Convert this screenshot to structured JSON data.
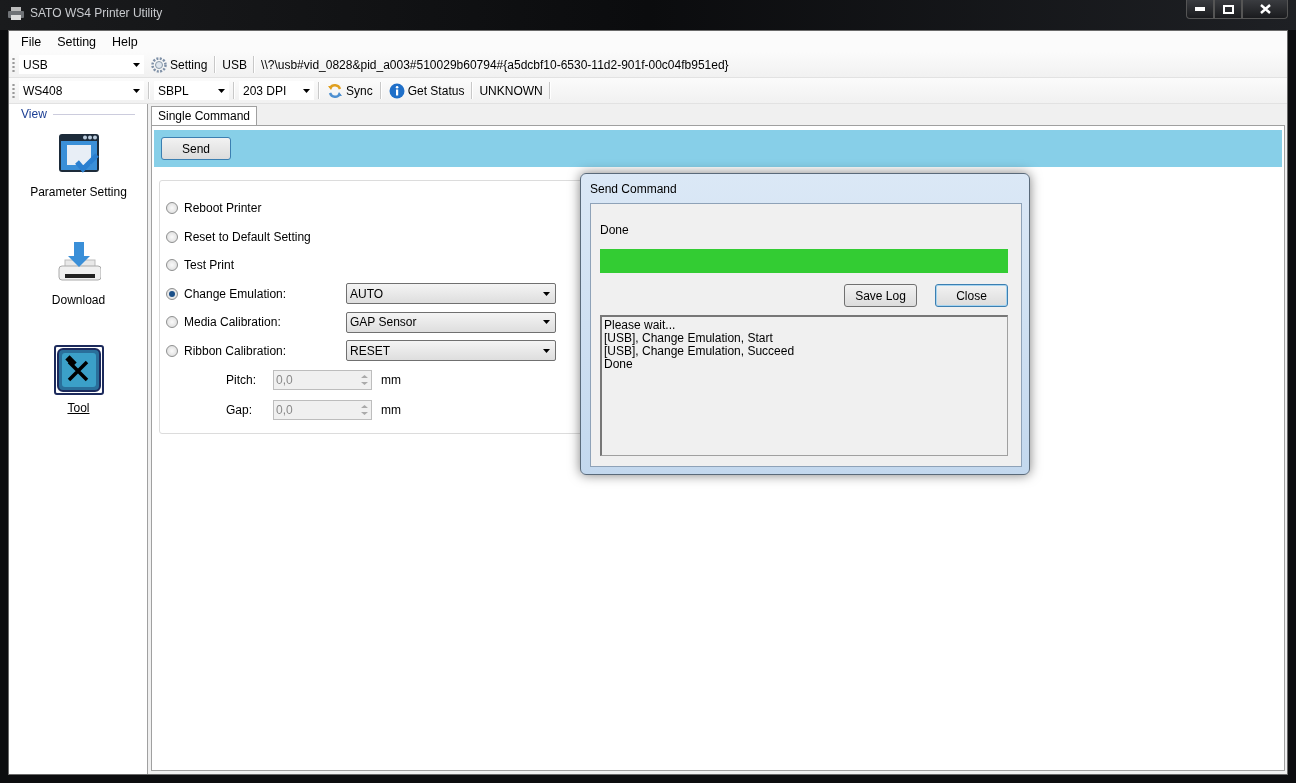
{
  "window": {
    "title": "SATO WS4 Printer Utility"
  },
  "menu": [
    "File",
    "Setting",
    "Help"
  ],
  "toolbar_1": {
    "port": "USB",
    "setting_button": "Setting",
    "port_label": "USB",
    "device_path": "\\\\?\\usb#vid_0828&pid_a003#510029b60794#{a5dcbf10-6530-11d2-901f-00c04fb951ed}"
  },
  "toolbar_2": {
    "model": "WS408",
    "language": "SBPL",
    "resolution": "203 DPI",
    "sync_button": "Sync",
    "status_button": "Get Status",
    "status": "UNKNOWN"
  },
  "sidebar": {
    "title": "View",
    "items": [
      {
        "kind": "parameter",
        "label": "Parameter Setting",
        "selected": false
      },
      {
        "kind": "download",
        "label": "Download",
        "selected": false
      },
      {
        "kind": "tool",
        "label": "Tool",
        "selected": true
      }
    ]
  },
  "tabs": [
    {
      "label": "Single Command",
      "selected": true
    }
  ],
  "send_button": "Send",
  "commands": [
    {
      "kind": "plain",
      "label": "Reboot Printer",
      "selected": false
    },
    {
      "kind": "plain",
      "label": "Reset to Default Setting",
      "selected": false
    },
    {
      "kind": "plain",
      "label": "Test Print",
      "selected": false
    },
    {
      "kind": "dropdown",
      "label": "Change Emulation:",
      "selected": true,
      "value": "AUTO"
    },
    {
      "kind": "dropdown",
      "label": "Media Calibration:",
      "selected": false,
      "value": "GAP Sensor"
    },
    {
      "kind": "dropdown",
      "label": "Ribbon Calibration:",
      "selected": false,
      "value": "RESET"
    }
  ],
  "fields": [
    {
      "label": "Pitch:",
      "value": "0,0",
      "unit": "mm",
      "disabled": true
    },
    {
      "label": "Gap:",
      "value": "0,0",
      "unit": "mm",
      "disabled": true
    }
  ],
  "dialog": {
    "title": "Send Command",
    "status": "Done",
    "progress": {
      "level": 1
    },
    "buttons": [
      "Save Log",
      "Close"
    ],
    "log": [
      "Please wait...",
      "[USB], Change Emulation, Start",
      "[USB], Change Emulation, Succeed",
      "Done"
    ]
  }
}
